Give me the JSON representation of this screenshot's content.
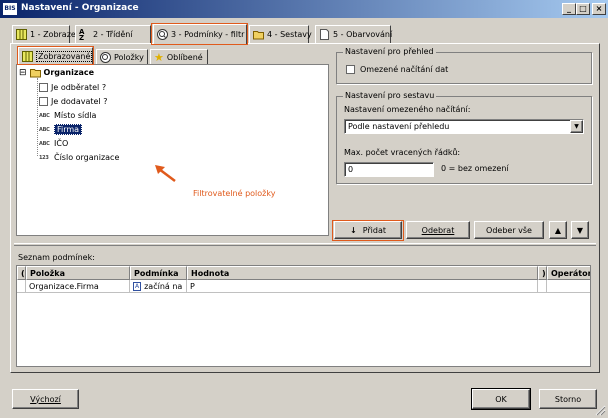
{
  "window": {
    "icon_text": "BIS",
    "title": "Nastavení - Organizace",
    "minimize": "_",
    "maximize": "□",
    "close": "×"
  },
  "tabs": [
    {
      "label": "1 - Zobrazení",
      "icon": "columns-icon"
    },
    {
      "label": "2 - Třídění",
      "icon": "sort-az-icon"
    },
    {
      "label": "3 - Podmínky - filtr",
      "icon": "filter-magnifier-icon",
      "active": true
    },
    {
      "label": "4 - Sestavy",
      "icon": "folder-icon"
    },
    {
      "label": "5 - Obarvování",
      "icon": "document-icon"
    }
  ],
  "subtabs": [
    {
      "label": "Zobrazované",
      "icon": "columns-icon",
      "active": true
    },
    {
      "label": "Položky",
      "icon": "magnifier-icon"
    },
    {
      "label": "Oblíbené",
      "icon": "star-icon"
    }
  ],
  "tree": {
    "root": {
      "expander": "⊟",
      "label": "Organizace"
    },
    "items": [
      {
        "type": "checkbox",
        "prefix": "",
        "label": "Je odběratel ?"
      },
      {
        "type": "checkbox",
        "prefix": "",
        "label": "Je dodavatel ?"
      },
      {
        "type": "abc",
        "prefix": "ABC",
        "label": "Místo sídla"
      },
      {
        "type": "abc",
        "prefix": "ABC",
        "label": "Firma",
        "selected": true
      },
      {
        "type": "abc",
        "prefix": "ABC",
        "label": "IČO"
      },
      {
        "type": "num",
        "prefix": "123",
        "label": "Číslo organizace"
      }
    ],
    "annotation": "Filtrovatelné položky"
  },
  "overview_settings": {
    "group_label": "Nastavení pro přehled",
    "checkbox_label": "Omezené načítání dat"
  },
  "report_settings": {
    "group_label": "Nastavení pro sestavu",
    "limited_loading_label": "Nastavení omezeného načítání:",
    "limited_loading_value": "Podle nastavení přehledu",
    "max_rows_label": "Max. počet vracených řádků:",
    "max_rows_value": "0",
    "max_rows_hint": "0 = bez omezení"
  },
  "actions": {
    "add": "Přidat",
    "add_icon": "↓",
    "remove": "Odebrat",
    "remove_all": "Odeber vše",
    "up": "▲",
    "down": "▼"
  },
  "conditions": {
    "label": "Seznam podmínek:",
    "columns": [
      "(",
      "Položka",
      "Podmínka",
      "Hodnota",
      ")",
      "Operátor"
    ],
    "rows": [
      {
        "open": "",
        "item": "Organizace.Firma",
        "condition_icon": "A",
        "condition": "začíná na",
        "value": "P",
        "close": "",
        "operator": ""
      }
    ]
  },
  "footer": {
    "default": "Výchozí",
    "ok": "OK",
    "cancel": "Storno"
  },
  "colors": {
    "title_start": "#0a246a",
    "title_end": "#a6caf0",
    "annotation": "#e05a1c",
    "selection": "#0a246a"
  }
}
